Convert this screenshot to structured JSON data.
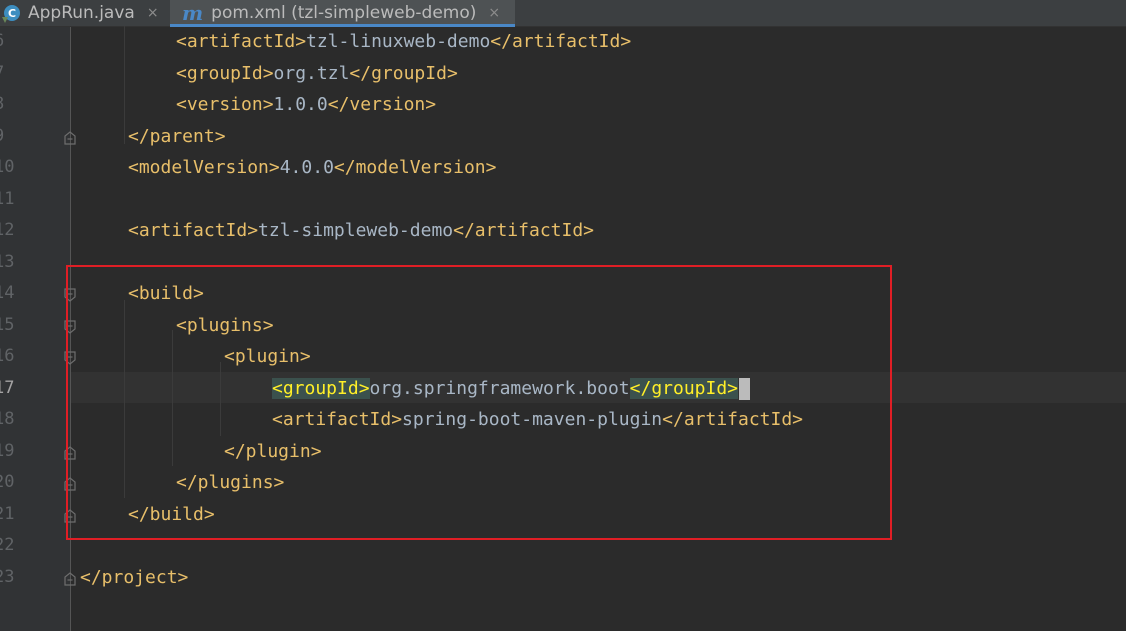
{
  "tabs": [
    {
      "label": "AppRun.java",
      "icon": "java-class-icon",
      "close": "×",
      "active": false
    },
    {
      "label": "pom.xml (tzl-simpleweb-demo)",
      "icon": "maven-icon",
      "icon_glyph": "m",
      "close": "×",
      "active": true
    }
  ],
  "editor": {
    "current_line": "17",
    "lines": [
      {
        "number": "6",
        "parts": [
          [
            "tag",
            "<artifactId>"
          ],
          [
            "txt",
            "tzl-linuxweb-demo"
          ],
          [
            "tag",
            "</artifactId>"
          ]
        ]
      },
      {
        "number": "7",
        "parts": [
          [
            "tag",
            "<groupId>"
          ],
          [
            "txt",
            "org.tzl"
          ],
          [
            "tag",
            "</groupId>"
          ]
        ]
      },
      {
        "number": "8",
        "parts": [
          [
            "tag",
            "<version>"
          ],
          [
            "txt",
            "1.0.0"
          ],
          [
            "tag",
            "</version>"
          ]
        ]
      },
      {
        "number": "9",
        "parts": [
          [
            "tag",
            "</parent>"
          ]
        ]
      },
      {
        "number": "10",
        "parts": [
          [
            "tag",
            "<modelVersion>"
          ],
          [
            "txt",
            "4.0.0"
          ],
          [
            "tag",
            "</modelVersion>"
          ]
        ]
      },
      {
        "number": "11",
        "parts": []
      },
      {
        "number": "12",
        "parts": [
          [
            "tag",
            "<artifactId>"
          ],
          [
            "txt",
            "tzl-simpleweb-demo"
          ],
          [
            "tag",
            "</artifactId>"
          ]
        ]
      },
      {
        "number": "13",
        "parts": []
      },
      {
        "number": "14",
        "parts": [
          [
            "tag",
            "<build>"
          ]
        ]
      },
      {
        "number": "15",
        "parts": [
          [
            "tag",
            "<plugins>"
          ]
        ]
      },
      {
        "number": "16",
        "parts": [
          [
            "tag",
            "<plugin>"
          ]
        ]
      },
      {
        "number": "17",
        "parts": [
          [
            "hl",
            "<groupId>"
          ],
          [
            "txt",
            "org.springframework.boot"
          ],
          [
            "hl",
            "</groupId>"
          ]
        ]
      },
      {
        "number": "18",
        "parts": [
          [
            "tag",
            "<artifactId>"
          ],
          [
            "txt",
            "spring-boot-maven-plugin"
          ],
          [
            "tag",
            "</artifactId>"
          ]
        ]
      },
      {
        "number": "19",
        "parts": [
          [
            "tag",
            "</plugin>"
          ]
        ]
      },
      {
        "number": "20",
        "parts": [
          [
            "tag",
            "</plugins>"
          ]
        ]
      },
      {
        "number": "21",
        "parts": [
          [
            "tag",
            "</build>"
          ]
        ]
      },
      {
        "number": "22",
        "parts": []
      },
      {
        "number": "23",
        "parts": [
          [
            "tag",
            "</project>"
          ]
        ]
      }
    ]
  },
  "colors": {
    "tag": "#e8bf6a",
    "text": "#a9b7c6",
    "highlight_tag": "#ffef28",
    "annotation_box": "#e01e25",
    "active_tab_underline": "#4a88c7"
  }
}
